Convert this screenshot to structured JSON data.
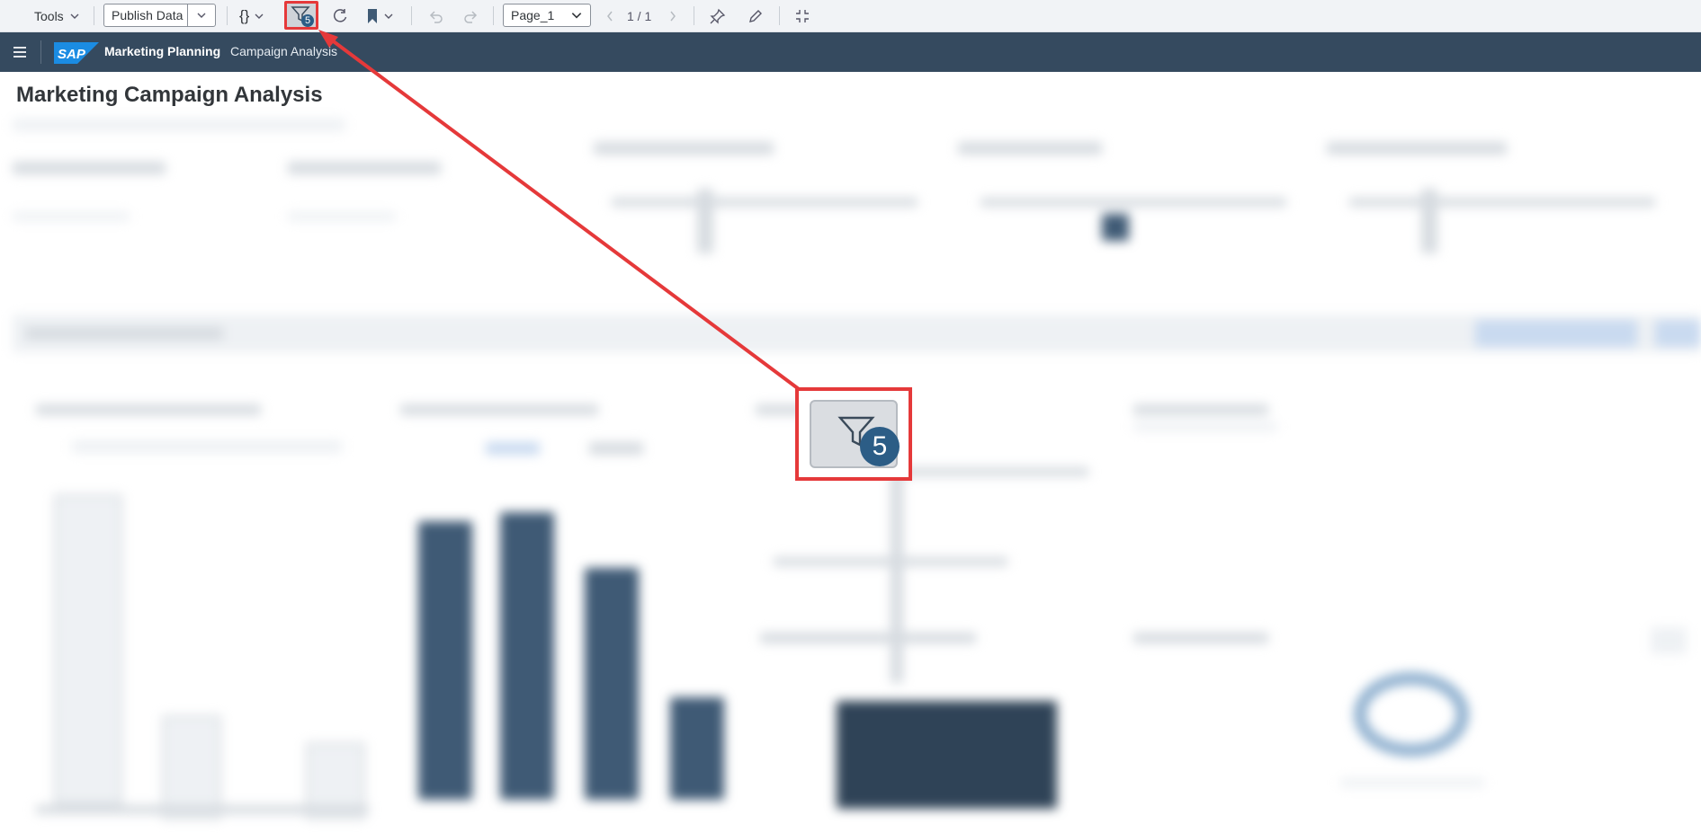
{
  "toolbar": {
    "tools_label": "Tools",
    "publish_label": "Publish Data",
    "braces_label": "{}",
    "filter_count": "5",
    "page_select_value": "Page_1",
    "page_count": "1 / 1"
  },
  "shell": {
    "logo_text": "SAP",
    "app_title": "Marketing Planning",
    "app_subtitle": "Campaign Analysis"
  },
  "page": {
    "title": "Marketing Campaign Analysis"
  },
  "annotation": {
    "zoom_badge_count": "5",
    "highlight_color": "#e5393a"
  },
  "colors": {
    "shell_bar": "#354a5f",
    "badge": "#2c5d86",
    "toolbar_bg": "#f1f3f6"
  }
}
